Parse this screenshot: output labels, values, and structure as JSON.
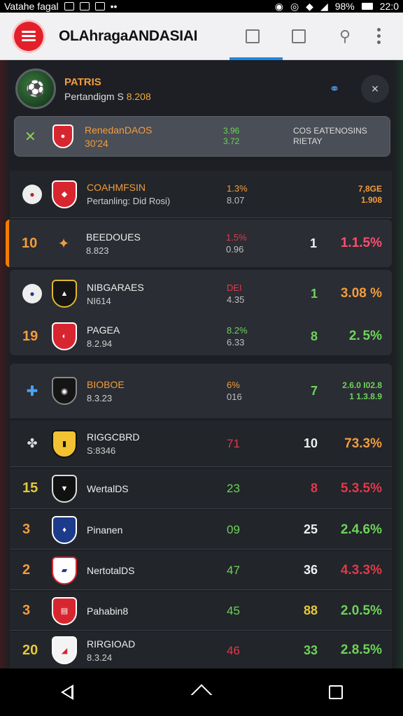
{
  "status_bar": {
    "carrier": "Vatahe fagal",
    "battery": "98%",
    "time": "22:0"
  },
  "app_bar": {
    "title": "OLAhragaANDASIAI",
    "colors": {
      "accent": "#e3202a",
      "tab_indicator": "#1e88e5"
    }
  },
  "team_header": {
    "name": "PATRIS",
    "sub_prefix": "Pertandigm S",
    "sub_value": "8.208"
  },
  "featured": {
    "name": "RenedanDAOS",
    "sub": "30'24",
    "stat1": "3.96",
    "stat2": "3.72",
    "desc1": "Cos Eatenosins",
    "desc2": "Rietay"
  },
  "rows": [
    {
      "rank": "",
      "name": "COAHMFSIN",
      "sub": "Pertanling: Did Rosi)",
      "stat1": "1.3%",
      "stat2": "8.07",
      "value": "",
      "pct1": "7,8GE",
      "pct2": "1.908"
    },
    {
      "rank": "10",
      "name": "BEEDOUES",
      "sub": "8.823",
      "stat1": "1.5%",
      "stat2": "0.96",
      "value": "1",
      "pct": "1.1.5%"
    },
    {
      "rank": "",
      "name": "NIBGARAES",
      "sub": "NI614",
      "stat1": "DEI",
      "stat2": "4.35",
      "value": "1",
      "pct": "3.08 %"
    },
    {
      "rank": "19",
      "name": "PAGEA",
      "sub": "8.2.94",
      "stat1": "8.2%",
      "stat2": "6.33",
      "value": "8",
      "pct": "2. 5%"
    },
    {
      "rank": "",
      "name": "BIOBOE",
      "sub": "8.3.23",
      "stat1": "6%",
      "stat2": "016",
      "value": "7",
      "pct1": "2.6.0 I02.8",
      "pct2": "1 1.3.8.9"
    },
    {
      "rank": "",
      "name": "RIGGCBRD",
      "sub": "S:8346",
      "stat1": "71",
      "stat2": "",
      "value": "10",
      "pct": "73.3%"
    },
    {
      "rank": "15",
      "name": "WertalDS",
      "sub": "",
      "stat1": "23",
      "stat2": "",
      "value": "8",
      "pct": "5.3.5%"
    },
    {
      "rank": "3",
      "name": "Pinanen",
      "sub": "",
      "stat1": "09",
      "stat2": "",
      "value": "25",
      "pct": "2.4.6%"
    },
    {
      "rank": "2",
      "name": "NertotalDS",
      "sub": "",
      "stat1": "47",
      "stat2": "",
      "value": "36",
      "pct": "4.3.3%"
    },
    {
      "rank": "3",
      "name": "Pahabin8",
      "sub": "",
      "stat1": "45",
      "stat2": "",
      "value": "88",
      "pct": "2.0.5%"
    },
    {
      "rank": "20",
      "name": "RIRGIOAD",
      "sub": "8.3.24",
      "stat1": "46",
      "stat2": "",
      "value": "33",
      "pct": "2.8.5%"
    }
  ]
}
